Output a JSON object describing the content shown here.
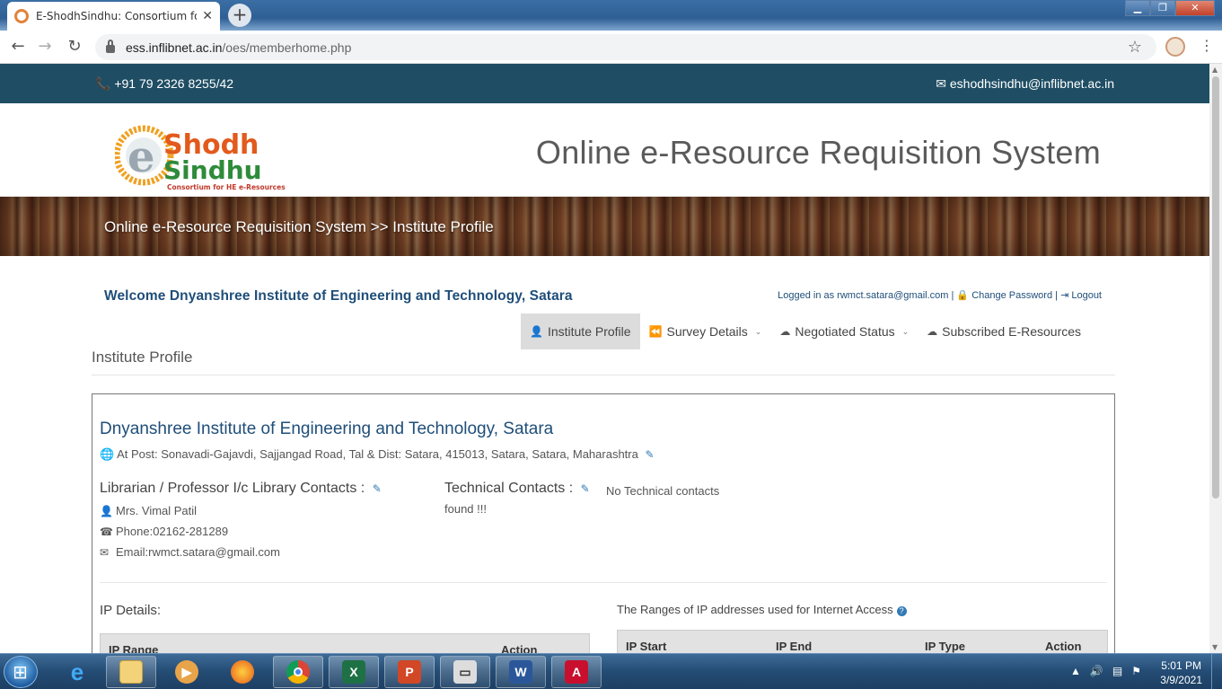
{
  "browser": {
    "tab_title": "E-ShodhSindhu: Consortium for H",
    "tab_close": "✕",
    "new_tab": "+",
    "url_host": "ess.inflibnet.ac.in",
    "url_path": "/oes/memberhome.php",
    "back": "←",
    "forward": "→",
    "reload": "↻",
    "star": "☆",
    "menu": "⋮"
  },
  "topbar": {
    "phone": "+91 79 2326 8255/42",
    "email": "eshodhsindhu@inflibnet.ac.in"
  },
  "header": {
    "logo_letters": [
      "e",
      "Shodh",
      "Sindhu"
    ],
    "logo_tagline": "Consortium for HE e-Resources",
    "system_title": "Online e-Resource Requisition System"
  },
  "banner": {
    "breadcrumb": "Online e-Resource Requisition System >> Institute Profile"
  },
  "welcome": "Welcome Dnyanshree Institute of Engineering and Technology, Satara",
  "login": {
    "logged_in": "Logged in as rwmct.satara@gmail.com",
    "sep": "|",
    "change_password": "Change Password",
    "logout": "Logout"
  },
  "nav": [
    {
      "label": "Institute Profile",
      "icon": "👤",
      "dropdown": false
    },
    {
      "label": "Survey Details",
      "icon": "⏪",
      "dropdown": true
    },
    {
      "label": "Negotiated Status",
      "icon": "☁",
      "dropdown": true
    },
    {
      "label": "Subscribed E-Resources",
      "icon": "☁",
      "dropdown": false
    }
  ],
  "section_title": "Institute Profile",
  "institute": {
    "name": "Dnyanshree Institute of Engineering and Technology, Satara",
    "address": "At Post: Sonavadi-Gajavdi, Sajjangad Road, Tal & Dist: Satara, 415013, Satara, Satara, Maharashtra",
    "librarian_heading": "Librarian / Professor I/c Library Contacts :",
    "librarian_name": "Mrs. Vimal Patil",
    "librarian_phone": "Phone:02162-281289",
    "librarian_email": "Email:rwmct.satara@gmail.com",
    "technical_heading": "Technical Contacts :",
    "technical_none": "No Technical contacts found !!!"
  },
  "ip_details": {
    "title": "IP Details:",
    "columns": [
      "IP Range",
      "Action"
    ]
  },
  "ip_ranges": {
    "title": "The Ranges of IP addresses used for Internet Access",
    "columns": [
      "IP Start",
      "IP End",
      "IP Type",
      "Action"
    ]
  },
  "taskbar": {
    "apps": [
      "Internet Explorer",
      "File Explorer",
      "Media Player",
      "Firefox",
      "Chrome",
      "Excel",
      "PowerPoint",
      "Scanner",
      "Word",
      "Adobe Acrobat"
    ],
    "time": "5:01 PM",
    "date": "3/9/2021"
  }
}
